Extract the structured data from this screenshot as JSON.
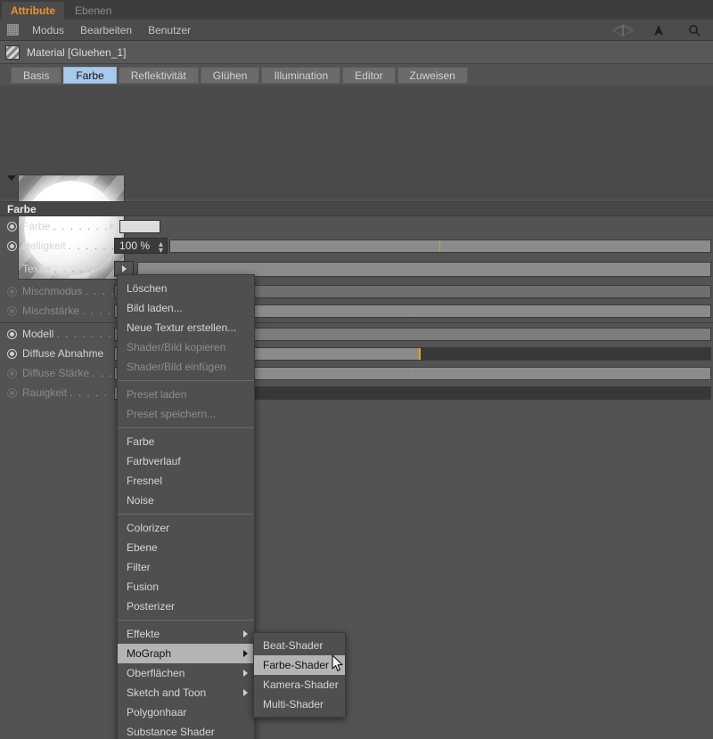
{
  "window": {
    "tabs": [
      {
        "label": "Attribute",
        "active": true
      },
      {
        "label": "Ebenen",
        "active": false
      }
    ]
  },
  "menubar": {
    "grid_icon": "grid-icon",
    "items": [
      "Modus",
      "Bearbeiten",
      "Benutzer"
    ],
    "right_icons": [
      "layers-wireframe-icon",
      "cursor-arrow-icon",
      "search-icon"
    ]
  },
  "object": {
    "icon": "material-hatch-icon",
    "title": "Material [Gluehen_1]"
  },
  "property_tabs": [
    {
      "label": "Basis",
      "selected": false
    },
    {
      "label": "Farbe",
      "selected": true
    },
    {
      "label": "Reflektivität",
      "selected": false
    },
    {
      "label": "Glühen",
      "selected": false
    },
    {
      "label": "Illumination",
      "selected": false
    },
    {
      "label": "Editor",
      "selected": false
    },
    {
      "label": "Zuweisen",
      "selected": false
    }
  ],
  "preview": {
    "material_name": "Gluehen_1"
  },
  "group": {
    "title": "Farbe"
  },
  "properties": [
    {
      "label": "Farbe",
      "dots": ". . . . . . . . . .",
      "radio": "on",
      "dim": false,
      "control": "color"
    },
    {
      "label": "Helligkeit",
      "dots": ". . . . . . . .",
      "radio": "on",
      "dim": false,
      "control": "number",
      "value": "100 %"
    },
    {
      "label": "Textur",
      "dots": ". . . . . . . . . .",
      "radio": "none",
      "dim": false,
      "control": "texture"
    },
    {
      "label": "Mischmodus",
      "dots": ". . . .",
      "radio": "dim",
      "dim": true,
      "control": "dropdown"
    },
    {
      "label": "Mischstärke",
      "dots": ". . . . .",
      "radio": "dim",
      "dim": true,
      "control": "slider"
    },
    {
      "label": "Modell",
      "dots": ". . . . . . . . . .",
      "radio": "on",
      "dim": false,
      "control": "dropdown"
    },
    {
      "label": "Diffuse Abnahme",
      "dots": "",
      "radio": "on",
      "dim": false,
      "control": "slider-marked"
    },
    {
      "label": "Diffuse Stärke",
      "dots": ". . .",
      "radio": "dim",
      "dim": true,
      "control": "slider"
    },
    {
      "label": "Rauigkeit",
      "dots": ". . . . . . .",
      "radio": "dim",
      "dim": true,
      "control": "slider-short"
    }
  ],
  "context_menu": {
    "items": [
      {
        "label": "Löschen",
        "state": "normal"
      },
      {
        "label": "Bild laden...",
        "state": "normal"
      },
      {
        "label": "Neue Textur erstellen...",
        "state": "normal"
      },
      {
        "label": "Shader/Bild kopieren",
        "state": "disabled"
      },
      {
        "label": "Shader/Bild einfügen",
        "state": "disabled"
      },
      {
        "separator": true
      },
      {
        "label": "Preset laden",
        "state": "disabled"
      },
      {
        "label": "Preset speichern...",
        "state": "disabled"
      },
      {
        "separator": true
      },
      {
        "label": "Farbe",
        "state": "normal"
      },
      {
        "label": "Farbverlauf",
        "state": "normal"
      },
      {
        "label": "Fresnel",
        "state": "normal"
      },
      {
        "label": "Noise",
        "state": "normal"
      },
      {
        "separator": true
      },
      {
        "label": "Colorizer",
        "state": "normal"
      },
      {
        "label": "Ebene",
        "state": "normal"
      },
      {
        "label": "Filter",
        "state": "normal"
      },
      {
        "label": "Fusion",
        "state": "normal"
      },
      {
        "label": "Posterizer",
        "state": "normal"
      },
      {
        "separator": true
      },
      {
        "label": "Effekte",
        "state": "normal",
        "submenu": true
      },
      {
        "label": "MoGraph",
        "state": "highlighted",
        "submenu": true
      },
      {
        "label": "Oberflächen",
        "state": "normal",
        "submenu": true
      },
      {
        "label": "Sketch and Toon",
        "state": "normal",
        "submenu": true
      },
      {
        "label": "Polygonhaar",
        "state": "normal"
      },
      {
        "label": "Substance Shader",
        "state": "normal"
      }
    ]
  },
  "submenu": {
    "parent": "MoGraph",
    "items": [
      {
        "label": "Beat-Shader",
        "state": "normal"
      },
      {
        "label": "Farbe-Shader",
        "state": "highlighted"
      },
      {
        "label": "Kamera-Shader",
        "state": "normal"
      },
      {
        "label": "Multi-Shader",
        "state": "normal"
      }
    ]
  },
  "colors": {
    "accent_orange": "#f0922b",
    "tab_selected": "#a8c8ec",
    "menu_highlight": "#b4b4b4",
    "slider_mark": "#e8a300",
    "panel_bg": "#535353"
  }
}
